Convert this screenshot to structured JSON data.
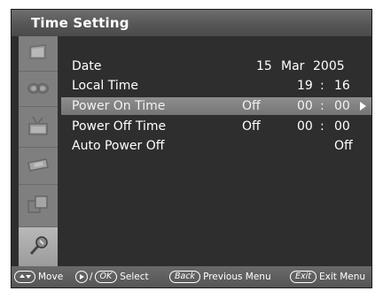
{
  "window": {
    "title": "Time Setting"
  },
  "sidebar": {
    "items": [
      {
        "icon": "picture-icon",
        "active": false
      },
      {
        "icon": "sound-icon",
        "active": false
      },
      {
        "icon": "channel-icon",
        "active": false
      },
      {
        "icon": "setup-icon",
        "active": false
      },
      {
        "icon": "input-icon",
        "active": false
      },
      {
        "icon": "tools-icon",
        "active": true
      }
    ]
  },
  "rows": [
    {
      "label": "Date",
      "day": "15",
      "month": "Mar",
      "year": "2005"
    },
    {
      "label": "Local Time",
      "hour": "19",
      "sep": ":",
      "minute": "16"
    },
    {
      "label": "Power On Time",
      "state": "Off",
      "hour": "00",
      "sep": ":",
      "minute": "00",
      "selected": true
    },
    {
      "label": "Power Off Time",
      "state": "Off",
      "hour": "00",
      "sep": ":",
      "minute": "00"
    },
    {
      "label": "Auto Power Off",
      "state": "Off"
    }
  ],
  "help": {
    "move": "Move",
    "ok_key": "OK",
    "select": "Select",
    "back_key": "Back",
    "previous_menu": "Previous Menu",
    "exit_key": "Exit",
    "exit_menu": "Exit Menu",
    "slash": "/"
  },
  "colors": {
    "panel": "#2e2e2e",
    "sidebar": "#7f7f7f",
    "highlight": "#7f7f7f",
    "text": "#ffffff"
  }
}
